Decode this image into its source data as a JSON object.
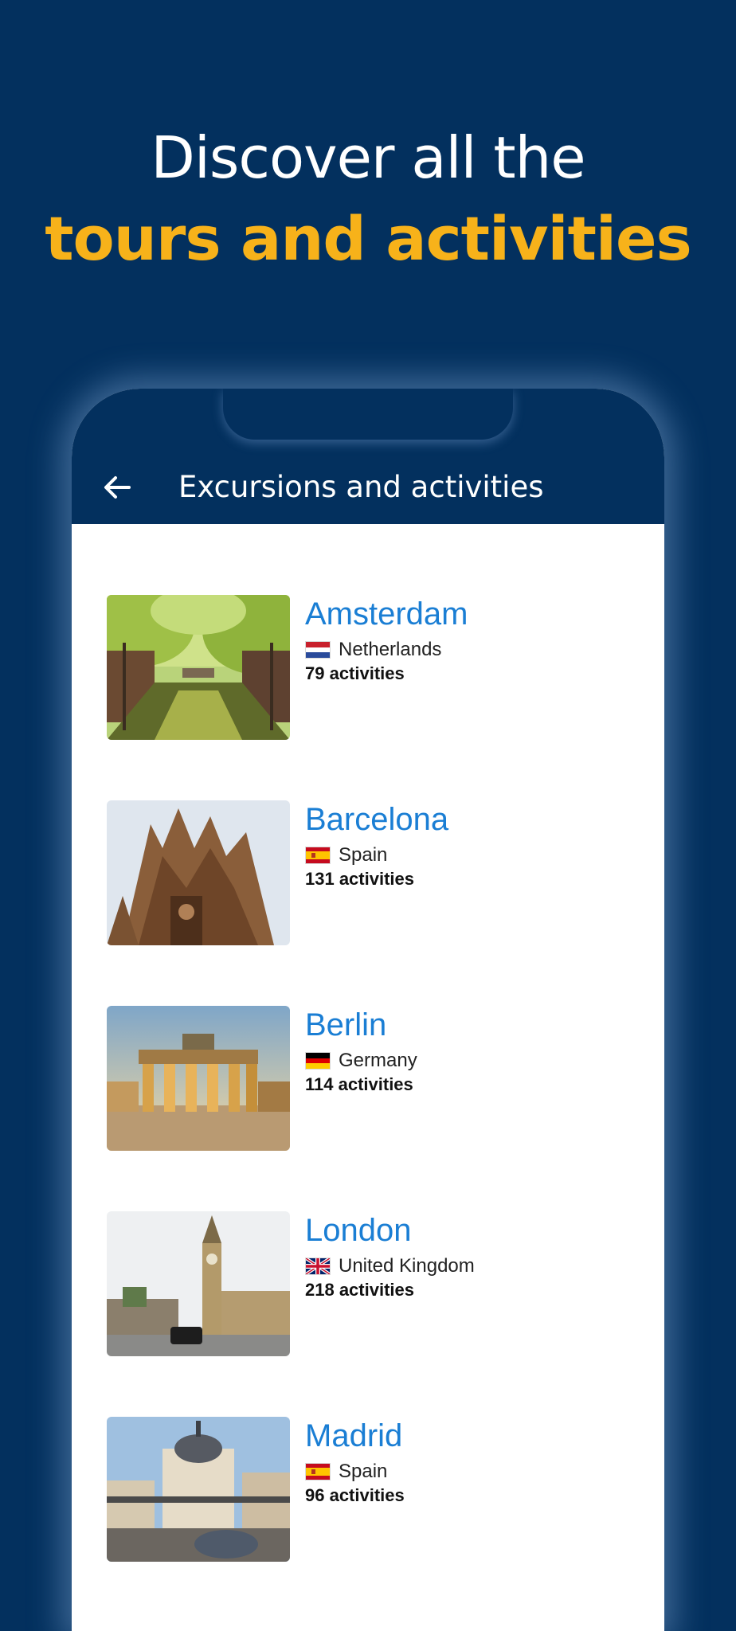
{
  "headline": {
    "line1": "Discover all the",
    "line2": "tours and activities"
  },
  "colors": {
    "background": "#03305e",
    "accent": "#f7b21a",
    "link": "#1a7ed4"
  },
  "appbar": {
    "back_icon": "arrow-left-icon",
    "title": "Excursions and activities"
  },
  "destinations": [
    {
      "city": "Amsterdam",
      "country": "Netherlands",
      "flag": "netherlands-flag-icon",
      "activities": "79 activities"
    },
    {
      "city": "Barcelona",
      "country": "Spain",
      "flag": "spain-flag-icon",
      "activities": "131 activities"
    },
    {
      "city": "Berlin",
      "country": "Germany",
      "flag": "germany-flag-icon",
      "activities": "114 activities"
    },
    {
      "city": "London",
      "country": "United Kingdom",
      "flag": "uk-flag-icon",
      "activities": "218 activities"
    },
    {
      "city": "Madrid",
      "country": "Spain",
      "flag": "spain-flag-icon",
      "activities": "96 activities"
    }
  ]
}
